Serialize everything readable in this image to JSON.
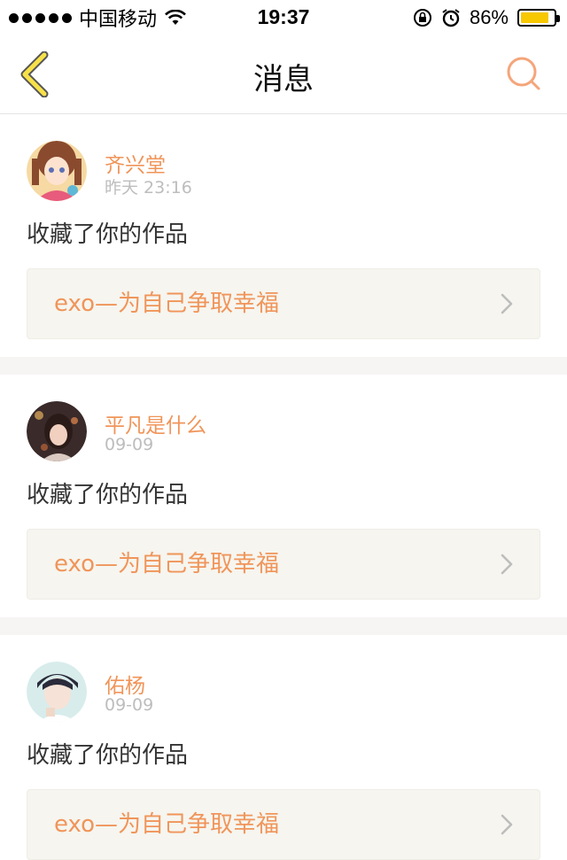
{
  "status_bar": {
    "carrier": "中国移动",
    "time": "19:37",
    "battery_percent": "86%",
    "battery_level": 0.86,
    "icons": [
      "signal-dots-icon",
      "wifi-icon",
      "orientation-lock-icon",
      "alarm-icon",
      "battery-icon"
    ]
  },
  "nav": {
    "title": "消息",
    "back_icon": "chevron-left-icon",
    "search_icon": "search-icon"
  },
  "colors": {
    "accent": "#f0955a",
    "back_icon": "#f7e14a",
    "card_bg": "#f6f5ef",
    "separator": "#f7f4f4"
  },
  "messages": [
    {
      "user": "齐兴堂",
      "time": "昨天 23:16",
      "action": "收藏了你的作品",
      "work_title": "exo—为自己争取幸福"
    },
    {
      "user": "平凡是什么",
      "time": "09-09",
      "action": "收藏了你的作品",
      "work_title": "exo—为自己争取幸福"
    },
    {
      "user": "佑杨",
      "time": "09-09",
      "action": "收藏了你的作品",
      "work_title": "exo—为自己争取幸福"
    }
  ]
}
